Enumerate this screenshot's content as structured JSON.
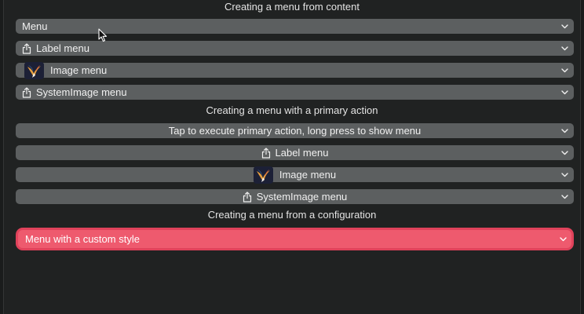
{
  "headings": {
    "content": "Creating a menu from content",
    "primary_action": "Creating a menu with a primary action",
    "configuration": "Creating a menu from a configuration"
  },
  "content_menus": {
    "menu": "Menu",
    "label_menu": "Label menu",
    "image_menu": "Image menu",
    "system_image_menu": "SystemImage menu"
  },
  "primary_action_menus": {
    "tap_menu": "Tap to execute primary action, long press to show menu",
    "label_menu": "Label menu",
    "image_menu": "Image menu",
    "system_image_menu": "SystemImage menu"
  },
  "configuration_menus": {
    "custom_style_menu": "Menu with a custom style"
  },
  "icons": {
    "share": "square-and-arrow-up-icon",
    "bird": "bird-image-icon",
    "chevron": "chevron-down-icon"
  },
  "colors": {
    "background": "#202222",
    "button": "#5c5f60",
    "custom_outer": "#e0425b",
    "custom_inner": "#ee5a6e"
  }
}
